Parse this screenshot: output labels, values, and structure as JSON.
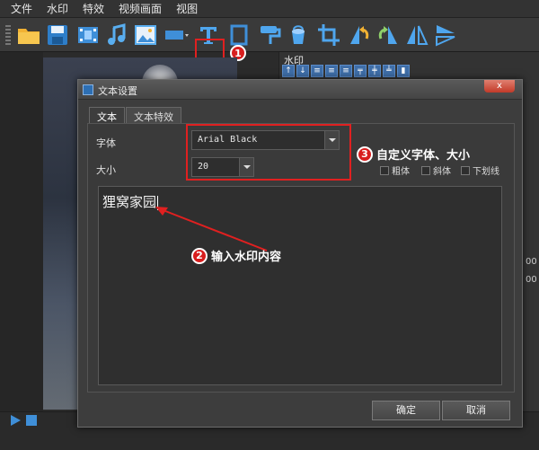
{
  "menu": [
    "文件",
    "水印",
    "特效",
    "视频画面",
    "视图"
  ],
  "toolbar": {
    "tools": [
      "folder-icon",
      "save-icon",
      "film-icon",
      "music-note-icon",
      "image-icon",
      "rectangle-icon",
      "text-tool-icon",
      "frame-icon",
      "paint-roller-icon",
      "bucket-icon",
      "crop-icon",
      "rotate-left-icon",
      "rotate-right-icon",
      "flip-horizontal-icon",
      "flip-vertical-icon"
    ],
    "badge_1": "1"
  },
  "right_panel": {
    "title": "水印",
    "side_numbers": [
      "00",
      "00"
    ]
  },
  "dialog": {
    "title": "文本设置",
    "close_label": "x",
    "tabs": [
      "文本",
      "文本特效"
    ],
    "font_label": "字体",
    "font_value": "Arial Black",
    "size_label": "大小",
    "size_value": "20",
    "checkboxes": [
      "粗体",
      "斜体",
      "下划线"
    ],
    "text_content": "狸窝家园",
    "ok_label": "确定",
    "cancel_label": "取消"
  },
  "annotations": {
    "badge_2": "2",
    "note_2": "输入水印内容",
    "badge_3": "3",
    "note_3": "自定义字体、大小"
  },
  "colors": {
    "annotation_red": "#e02020",
    "accent_blue": "#3f8fd8"
  }
}
